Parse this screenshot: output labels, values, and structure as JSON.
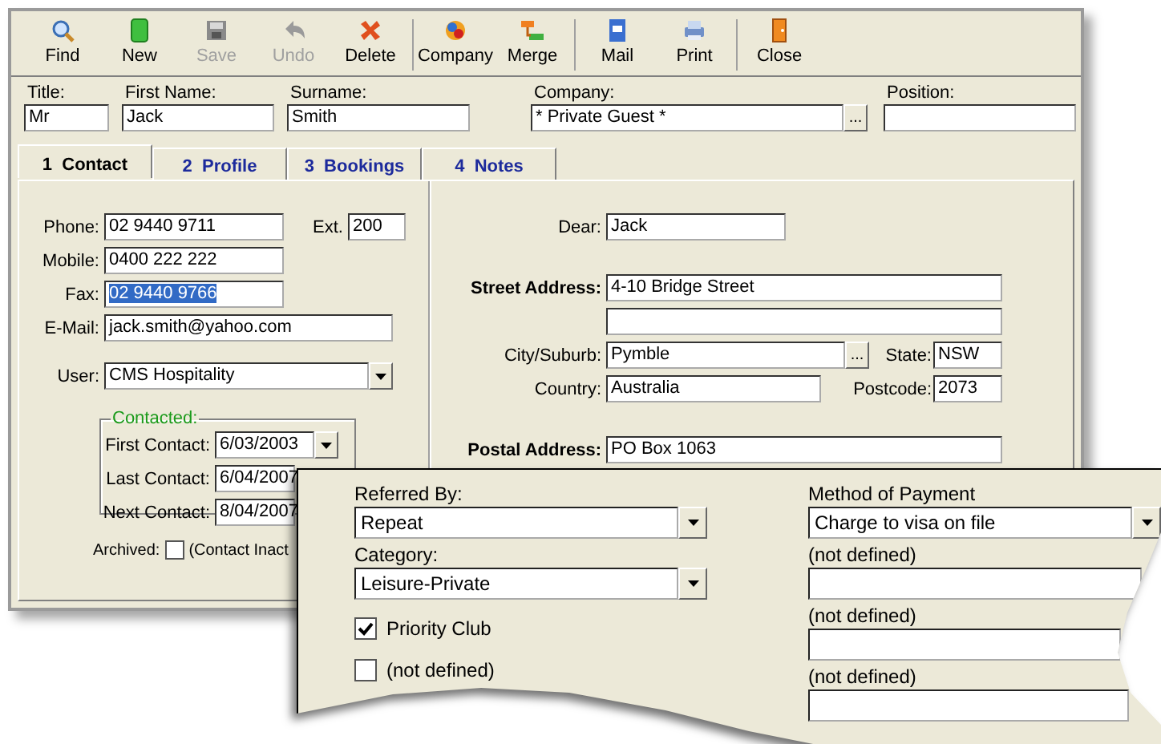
{
  "toolbar": {
    "groups": [
      [
        {
          "label": "Find",
          "disabled": false
        },
        {
          "label": "New",
          "disabled": false
        },
        {
          "label": "Save",
          "disabled": true
        },
        {
          "label": "Undo",
          "disabled": true
        },
        {
          "label": "Delete",
          "disabled": false
        }
      ],
      [
        {
          "label": "Company",
          "disabled": false
        },
        {
          "label": "Merge",
          "disabled": false
        }
      ],
      [
        {
          "label": "Mail",
          "disabled": false
        },
        {
          "label": "Print",
          "disabled": false
        }
      ],
      [
        {
          "label": "Close",
          "disabled": false
        }
      ]
    ]
  },
  "header": {
    "fields": [
      {
        "label": "Title:",
        "value": "Mr",
        "kind": "text"
      },
      {
        "label": "First Name:",
        "value": "Jack",
        "kind": "text"
      },
      {
        "label": "Surname:",
        "value": "Smith",
        "kind": "text"
      },
      {
        "label": "Company:",
        "value": "* Private Guest *",
        "kind": "lookup",
        "button": "..."
      },
      {
        "label": "Position:",
        "kind": "text"
      }
    ]
  },
  "tabs": [
    {
      "label": "1  Contact",
      "selected": true
    },
    {
      "label": "2  Profile",
      "selected": false
    },
    {
      "label": "3  Bookings",
      "selected": false
    },
    {
      "label": "4  Notes",
      "selected": false
    }
  ],
  "contact": {
    "fields": [
      {
        "label": "Phone:",
        "value": "02 9440 9711",
        "text_selected": false
      },
      {
        "label": "Mobile:",
        "value": "0400 222 222",
        "text_selected": false
      },
      {
        "label": "Fax:",
        "value": "02 9440 9766",
        "text_selected": true
      },
      {
        "label": "E-Mail:",
        "value": "jack.smith@yahoo.com",
        "text_selected": false
      }
    ],
    "ext": {
      "label": "Ext.",
      "value": "200"
    },
    "user": {
      "label": "User:",
      "value": "CMS Hospitality"
    },
    "contacted": {
      "title": "Contacted:",
      "rows": [
        {
          "label": "First Contact:",
          "value": "6/03/2003",
          "kind": "dropdown"
        },
        {
          "label": "Last Contact:",
          "value": "6/04/2007",
          "kind": "text"
        },
        {
          "label": "Next Contact:",
          "value": "8/04/2007",
          "kind": "text"
        }
      ]
    },
    "archived": {
      "label": "Archived:",
      "checked": false,
      "note": "(Contact Inact"
    }
  },
  "address": {
    "dear": {
      "label": "Dear:",
      "value": "Jack"
    },
    "street": {
      "label": "Street Address:",
      "lines": [
        "4-10 Bridge Street"
      ]
    },
    "city": {
      "label": "City/Suburb:",
      "value": "Pymble",
      "button": "..."
    },
    "state": {
      "label": "State:",
      "value": "NSW"
    },
    "country": {
      "label": "Country:",
      "value": "Australia"
    },
    "postcode": {
      "label": "Postcode:",
      "value": "2073"
    },
    "postal": {
      "label": "Postal Address:",
      "value": "PO Box 1063"
    }
  },
  "profile_panel": {
    "left": [
      {
        "kind": "dropdown",
        "label": "Referred By:",
        "value": "Repeat"
      },
      {
        "kind": "dropdown",
        "label": "Category:",
        "value": "Leisure-Private"
      },
      {
        "kind": "checkbox",
        "label": "Priority Club",
        "checked": true
      },
      {
        "kind": "checkbox",
        "label": "(not defined)",
        "checked": false
      }
    ],
    "right": [
      {
        "kind": "dropdown",
        "label": "Method of Payment",
        "value": "Charge to visa on file"
      },
      {
        "kind": "text",
        "label": "(not defined)"
      },
      {
        "kind": "text",
        "label": "(not defined)"
      },
      {
        "kind": "text",
        "label": "(not defined)"
      }
    ]
  }
}
